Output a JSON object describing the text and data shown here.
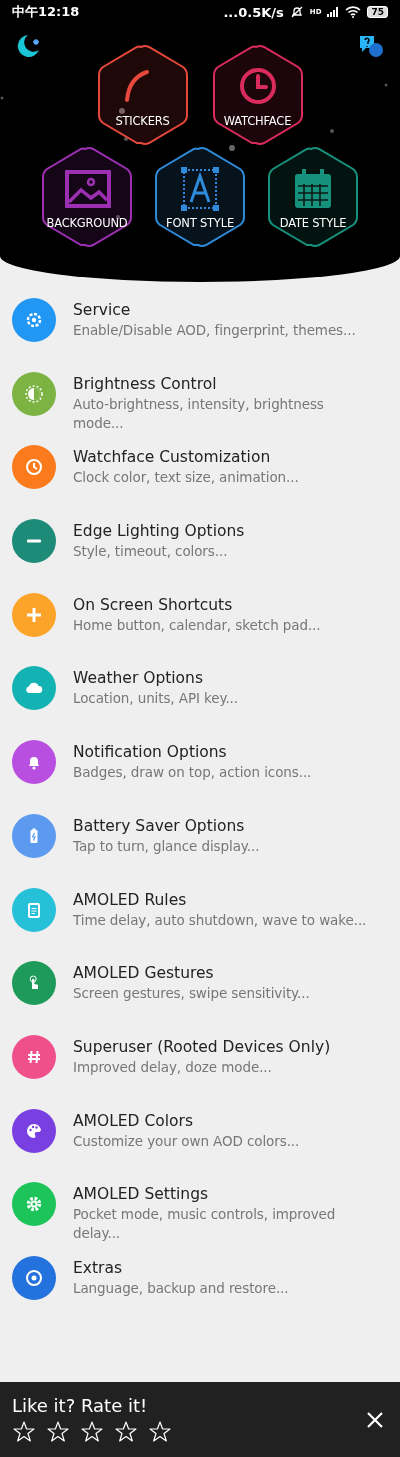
{
  "status_bar": {
    "time": "中午12:18",
    "speed": "...0.5K/s",
    "network_badge": "HD",
    "battery": "75"
  },
  "header": {
    "tiles": [
      {
        "label": "STICKERS",
        "color": "#e5483c"
      },
      {
        "label": "WATCHFACE",
        "color": "#da2c5c"
      },
      {
        "label": "BACKGROUND",
        "color": "#9d30b2"
      },
      {
        "label": "FONT STYLE",
        "color": "#2f8ad9"
      },
      {
        "label": "DATE STYLE",
        "color": "#16927c"
      }
    ]
  },
  "menu": [
    {
      "title": "Service",
      "subtitle": "Enable/Disable AOD, fingerprint, themes...",
      "color": "#2196f3"
    },
    {
      "title": "Brightness Control",
      "subtitle": "Auto-brightness, intensity, brightness mode...",
      "color": "#7cb342"
    },
    {
      "title": "Watchface Customization",
      "subtitle": "Clock color, text size, animation...",
      "color": "#fb7a1c"
    },
    {
      "title": "Edge Lighting Options",
      "subtitle": "Style, timeout, colors...",
      "color": "#1e8a78"
    },
    {
      "title": "On Screen Shortcuts",
      "subtitle": "Home button, calendar, sketch pad...",
      "color": "#fca42a"
    },
    {
      "title": "Weather Options",
      "subtitle": "Location, units, API key...",
      "color": "#14b3b3"
    },
    {
      "title": "Notification Options",
      "subtitle": "Badges, draw on top, action icons...",
      "color": "#b94fe0"
    },
    {
      "title": "Battery Saver Options",
      "subtitle": "Tap to turn, glance display...",
      "color": "#5c9af0"
    },
    {
      "title": "AMOLED Rules",
      "subtitle": "Time delay, auto shutdown, wave to wake...",
      "color": "#26c0d8"
    },
    {
      "title": "AMOLED Gestures",
      "subtitle": "Screen gestures, swipe sensitivity...",
      "color": "#1e9a5a"
    },
    {
      "title": "Superuser (Rooted Devices Only)",
      "subtitle": "Improved delay, doze mode...",
      "color": "#f0508a"
    },
    {
      "title": "AMOLED Colors",
      "subtitle": "Customize your own AOD colors...",
      "color": "#7a3fe0"
    },
    {
      "title": "AMOLED Settings",
      "subtitle": "Pocket mode, music controls, improved delay...",
      "color": "#1dc45a"
    },
    {
      "title": "Extras",
      "subtitle": "Language, backup and restore...",
      "color": "#2372dd"
    }
  ],
  "rating": {
    "prompt": "Like it? Rate it!",
    "stars": 0
  }
}
